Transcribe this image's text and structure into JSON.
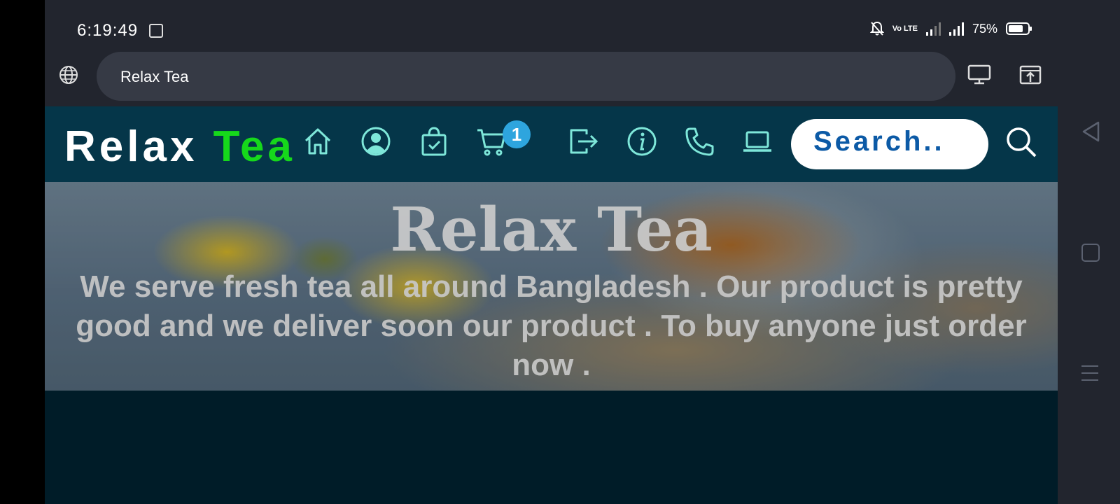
{
  "status_bar": {
    "time": "6:19:49",
    "battery": "75%",
    "battery_level": 0.75,
    "volte": "Vo LTE"
  },
  "browser": {
    "url_text": "Relax Tea"
  },
  "site": {
    "logo_part1": "Relax ",
    "logo_part2": "Tea",
    "cart_count": "1",
    "search_placeholder": "Search..",
    "accent_green": "#16d81b",
    "navbar_bg": "#053649",
    "icon_color": "#7ee7d9"
  },
  "nav_icons": [
    "home-icon",
    "user-icon",
    "bag-check-icon",
    "cart-icon",
    "logout-icon",
    "info-icon",
    "phone-icon",
    "laptop-icon",
    "search-icon"
  ],
  "hero": {
    "title": "Relax Tea",
    "text": "We serve fresh tea all around Bangladesh . Our product is pretty good and we deliver soon our product . To buy anyone just order now ."
  }
}
